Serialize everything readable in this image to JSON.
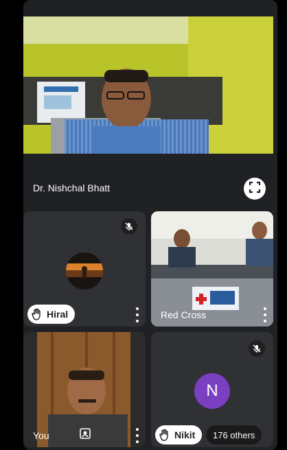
{
  "main_tile": {
    "participant_name": "Dr. Nishchal Bhatt",
    "fullscreen_icon": "fullscreen-icon"
  },
  "tiles": [
    {
      "name": "Hiral",
      "hand_raised": true,
      "muted": true,
      "avatar": "silhouette-at-sunset"
    },
    {
      "name": "Red Cross",
      "hand_raised": false,
      "muted": false,
      "banner_text": ""
    },
    {
      "name": "You",
      "hand_raised": false,
      "muted": false
    },
    {
      "name": "Nikit",
      "avatar_letter": "N",
      "hand_raised": true,
      "muted": true
    }
  ],
  "others_badge": "176 others",
  "colors": {
    "tile_bg": "#303134",
    "panel_bg": "#202124",
    "avatar_purple": "#7b3fc2",
    "chip_bg": "#ffffff"
  }
}
